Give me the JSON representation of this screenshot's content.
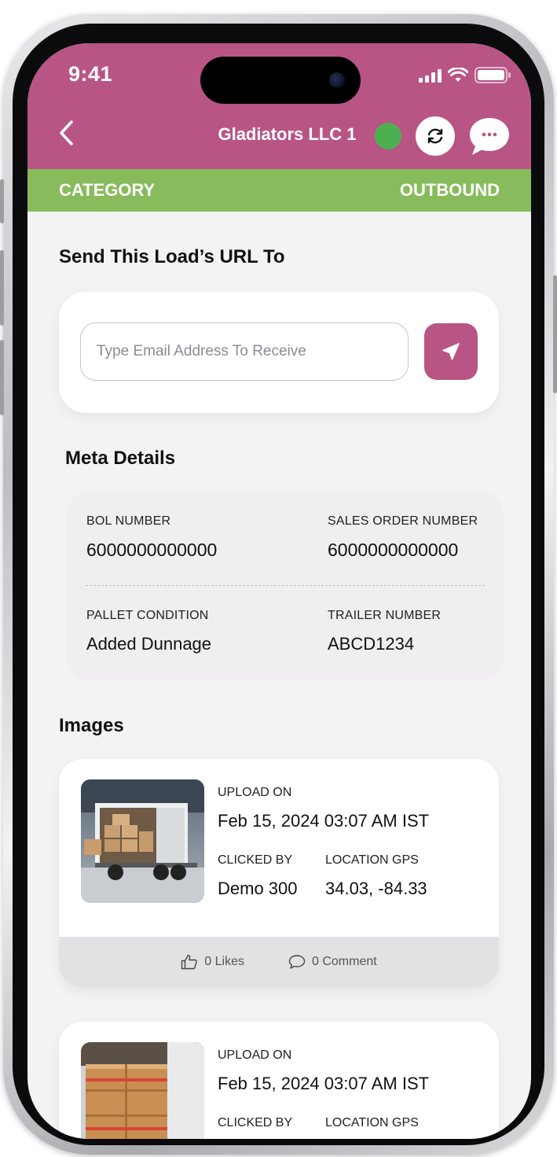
{
  "status_bar": {
    "time": "9:41"
  },
  "header": {
    "title": "Gladiators LLC 1"
  },
  "category_bar": {
    "label": "CATEGORY",
    "value": "OUTBOUND"
  },
  "send_url": {
    "title": "Send This Load’s URL To",
    "placeholder": "Type Email Address To Receive"
  },
  "meta": {
    "title": "Meta Details",
    "bol_label": "BOL NUMBER",
    "bol_value": "6000000000000",
    "sales_label": "SALES ORDER NUMBER",
    "sales_value": "6000000000000",
    "pallet_label": "PALLET CONDITION",
    "pallet_value": "Added Dunnage",
    "trailer_label": "TRAILER NUMBER",
    "trailer_value": "ABCD1234"
  },
  "images": {
    "title": "Images",
    "items": [
      {
        "upload_label": "UPLOAD ON",
        "upload_value": "Feb 15, 2024 03:07 AM IST",
        "clicked_label": "CLICKED BY",
        "clicked_value": "Demo 300",
        "gps_label": "LOCATION GPS",
        "gps_value": "34.03, -84.33",
        "likes": "0 Likes",
        "comments": "0 Comment"
      },
      {
        "upload_label": "UPLOAD ON",
        "upload_value": "Feb 15, 2024 03:07 AM IST",
        "clicked_label": "CLICKED BY",
        "gps_label": "LOCATION GPS"
      }
    ]
  },
  "colors": {
    "brand": "#b85585",
    "category_green": "#88bb5c",
    "online": "#4cb050"
  }
}
